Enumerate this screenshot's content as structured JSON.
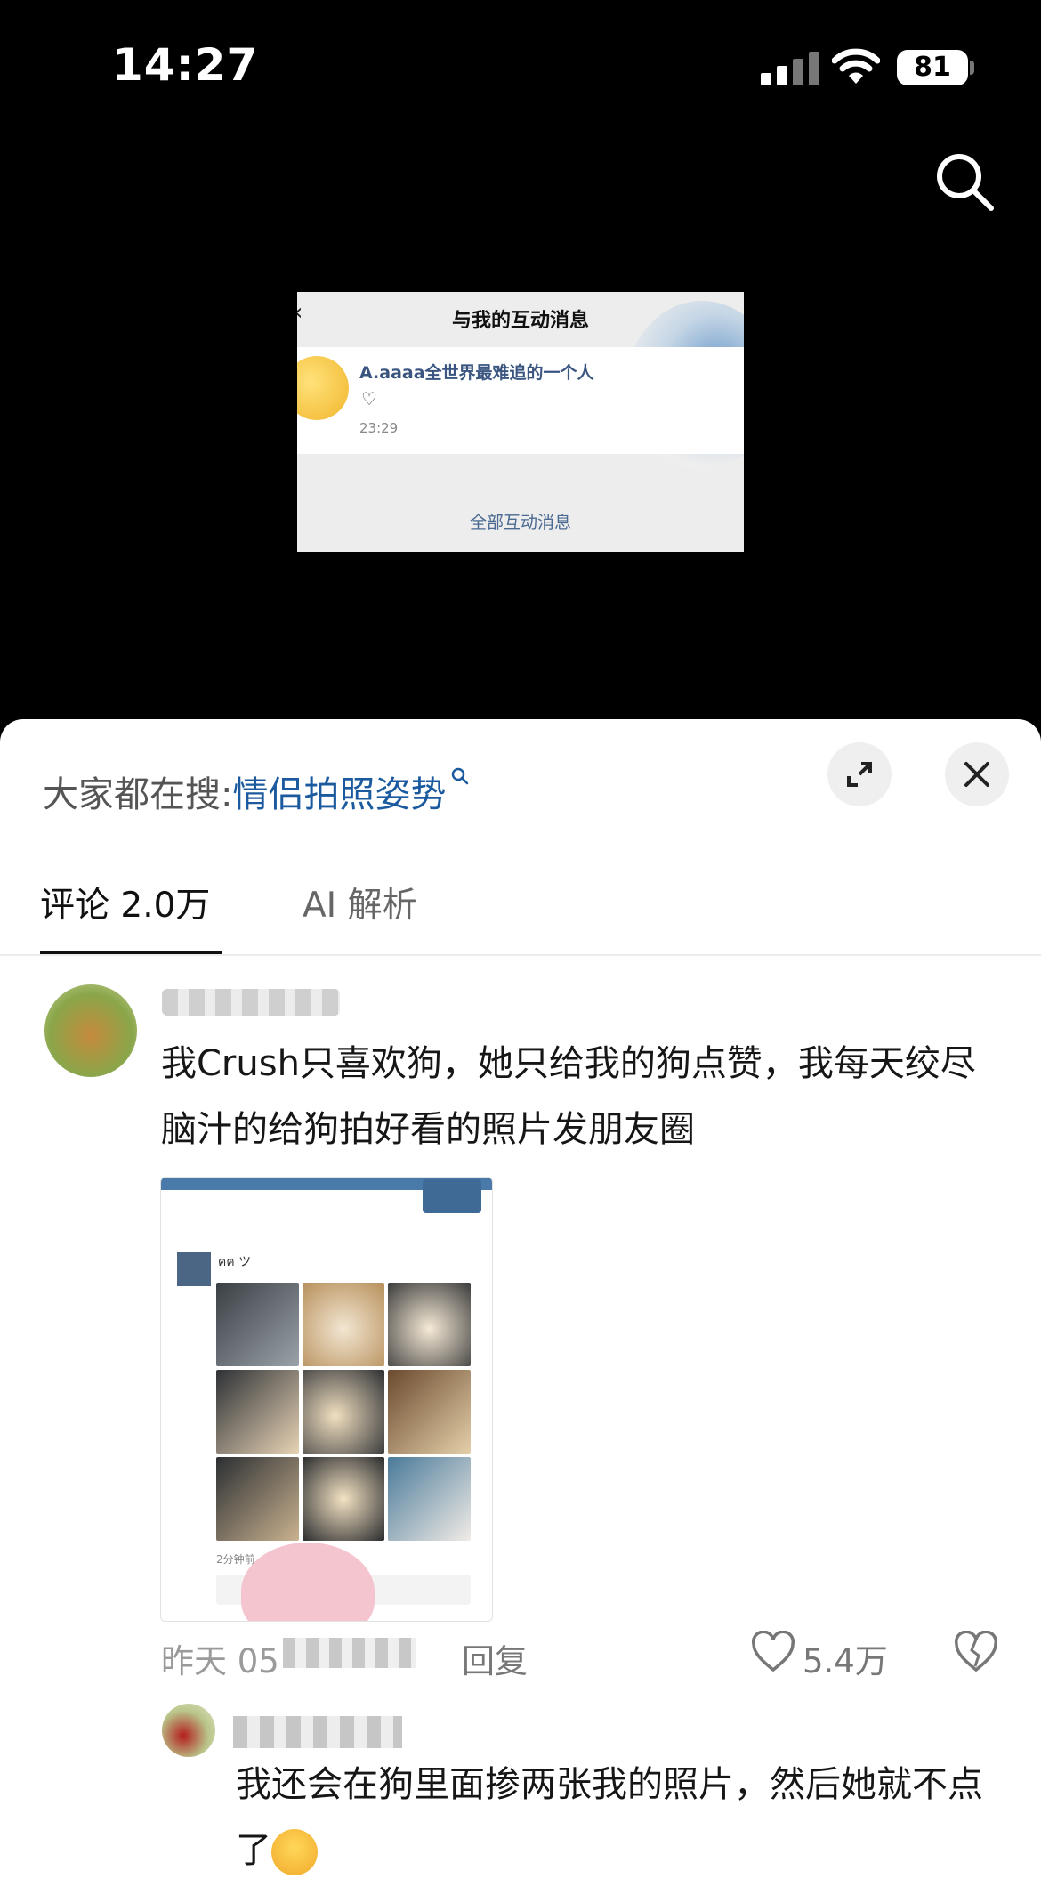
{
  "status_bar": {
    "time": "14:27",
    "battery": "81"
  },
  "screenshot": {
    "title": "与我的互动消息",
    "sender": "A.aaaa全世界最难追的一个人",
    "time": "23:29",
    "all_messages": "全部互动消息"
  },
  "sheet": {
    "hot_search_label": "大家都在搜:",
    "hot_search_term": "情侣拍照姿势",
    "tabs": {
      "comments": "评论 2.0万",
      "ai": "AI 解析"
    }
  },
  "comments": [
    {
      "text": "我Crush只喜欢狗，她只给我的狗点赞，我每天绞尽脑汁的给狗拍好看的照片发朋友圈",
      "time_prefix": "昨天 05",
      "reply": "回复",
      "likes": "5.4万",
      "image": {
        "poster": "ฅฅ ツ",
        "time": "2分钟前"
      }
    },
    {
      "text": "我还会在狗里面掺两张我的照片，然后她就不点了"
    }
  ],
  "colors": {
    "accent": "#1b5a9e",
    "background": "#000000",
    "sheet": "#ffffff"
  }
}
